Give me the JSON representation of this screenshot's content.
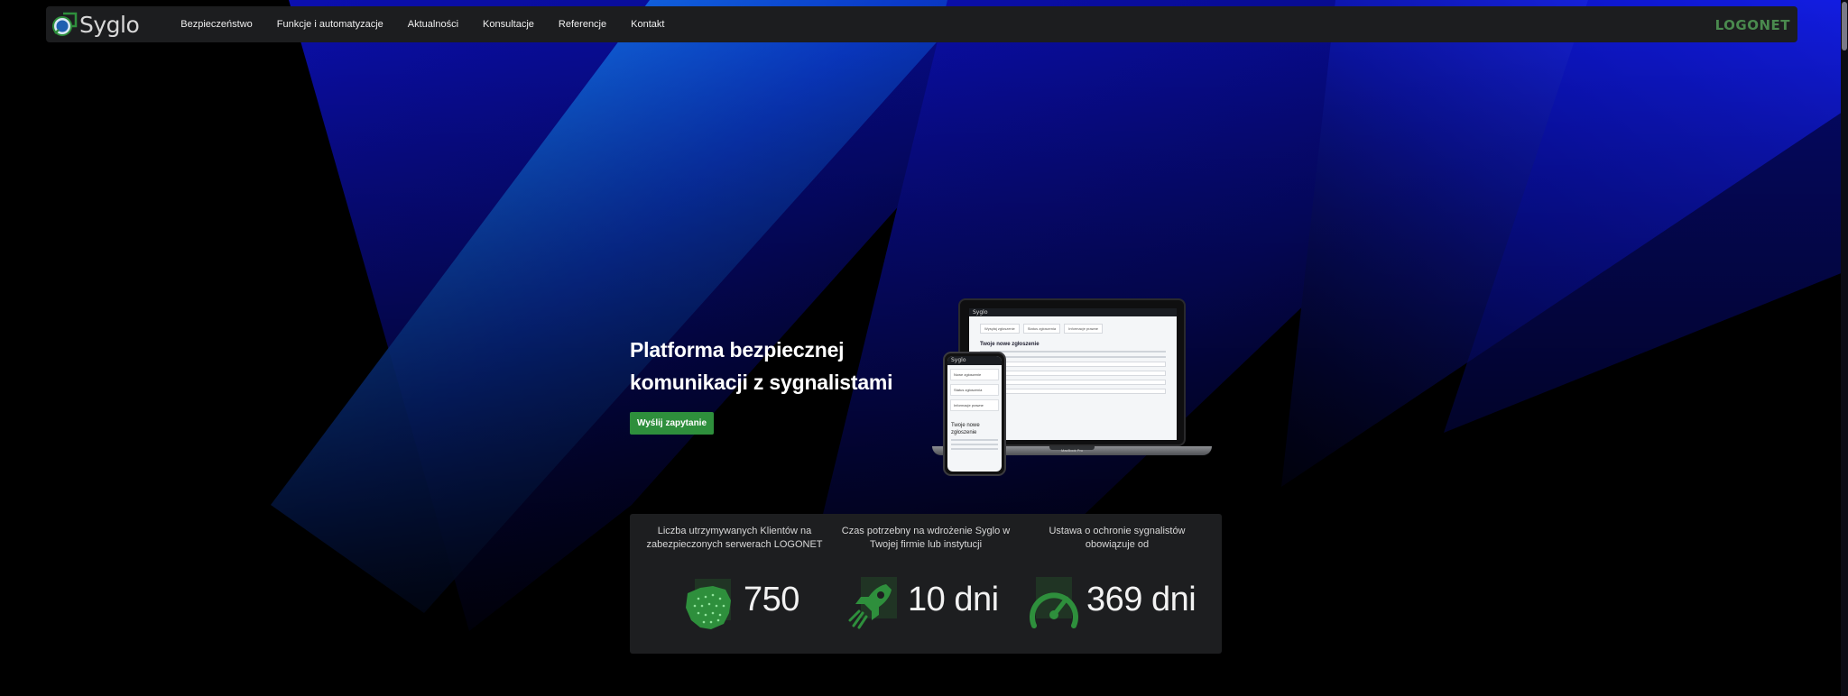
{
  "brand": {
    "name": "Syglo",
    "partner_logo": "LOGONET",
    "accent_color": "#2e8f3c"
  },
  "nav": {
    "items": [
      {
        "label": "Bezpieczeństwo"
      },
      {
        "label": "Funkcje i automatyzacje"
      },
      {
        "label": "Aktualności"
      },
      {
        "label": "Konsultacje"
      },
      {
        "label": "Referencje"
      },
      {
        "label": "Kontakt"
      }
    ]
  },
  "hero": {
    "title": "Platforma bezpiecznej komunikacji z sygnalistami",
    "cta_label": "Wyślij zapytanie"
  },
  "mockup": {
    "laptop_brand": "Syglo",
    "laptop_tabs": [
      "Wysyłaj zgłoszenie",
      "Status zgłoszenia",
      "Informacje prawne"
    ],
    "laptop_heading": "Twoje nowe zgłoszenie",
    "laptop_caption": "MacBook Pro",
    "phone_brand": "Syglo",
    "phone_items": [
      "Nowe zgłoszenie",
      "Status zgłoszenia",
      "Informacje prawne"
    ],
    "phone_heading": "Twoje nowe zgłoszenie"
  },
  "stats": [
    {
      "label": "Liczba utrzymywanych Klientów na zabezpieczonych serwerach LOGONET",
      "value": "750",
      "icon": "poland-map-icon"
    },
    {
      "label": "Czas potrzebny na wdrożenie Syglo w Twojej firmie lub instytucji",
      "value": "10 dni",
      "icon": "rocket-icon"
    },
    {
      "label": "Ustawa o ochronie sygnalistów obowiązuje od",
      "value": "369 dni",
      "icon": "speedometer-icon"
    }
  ]
}
